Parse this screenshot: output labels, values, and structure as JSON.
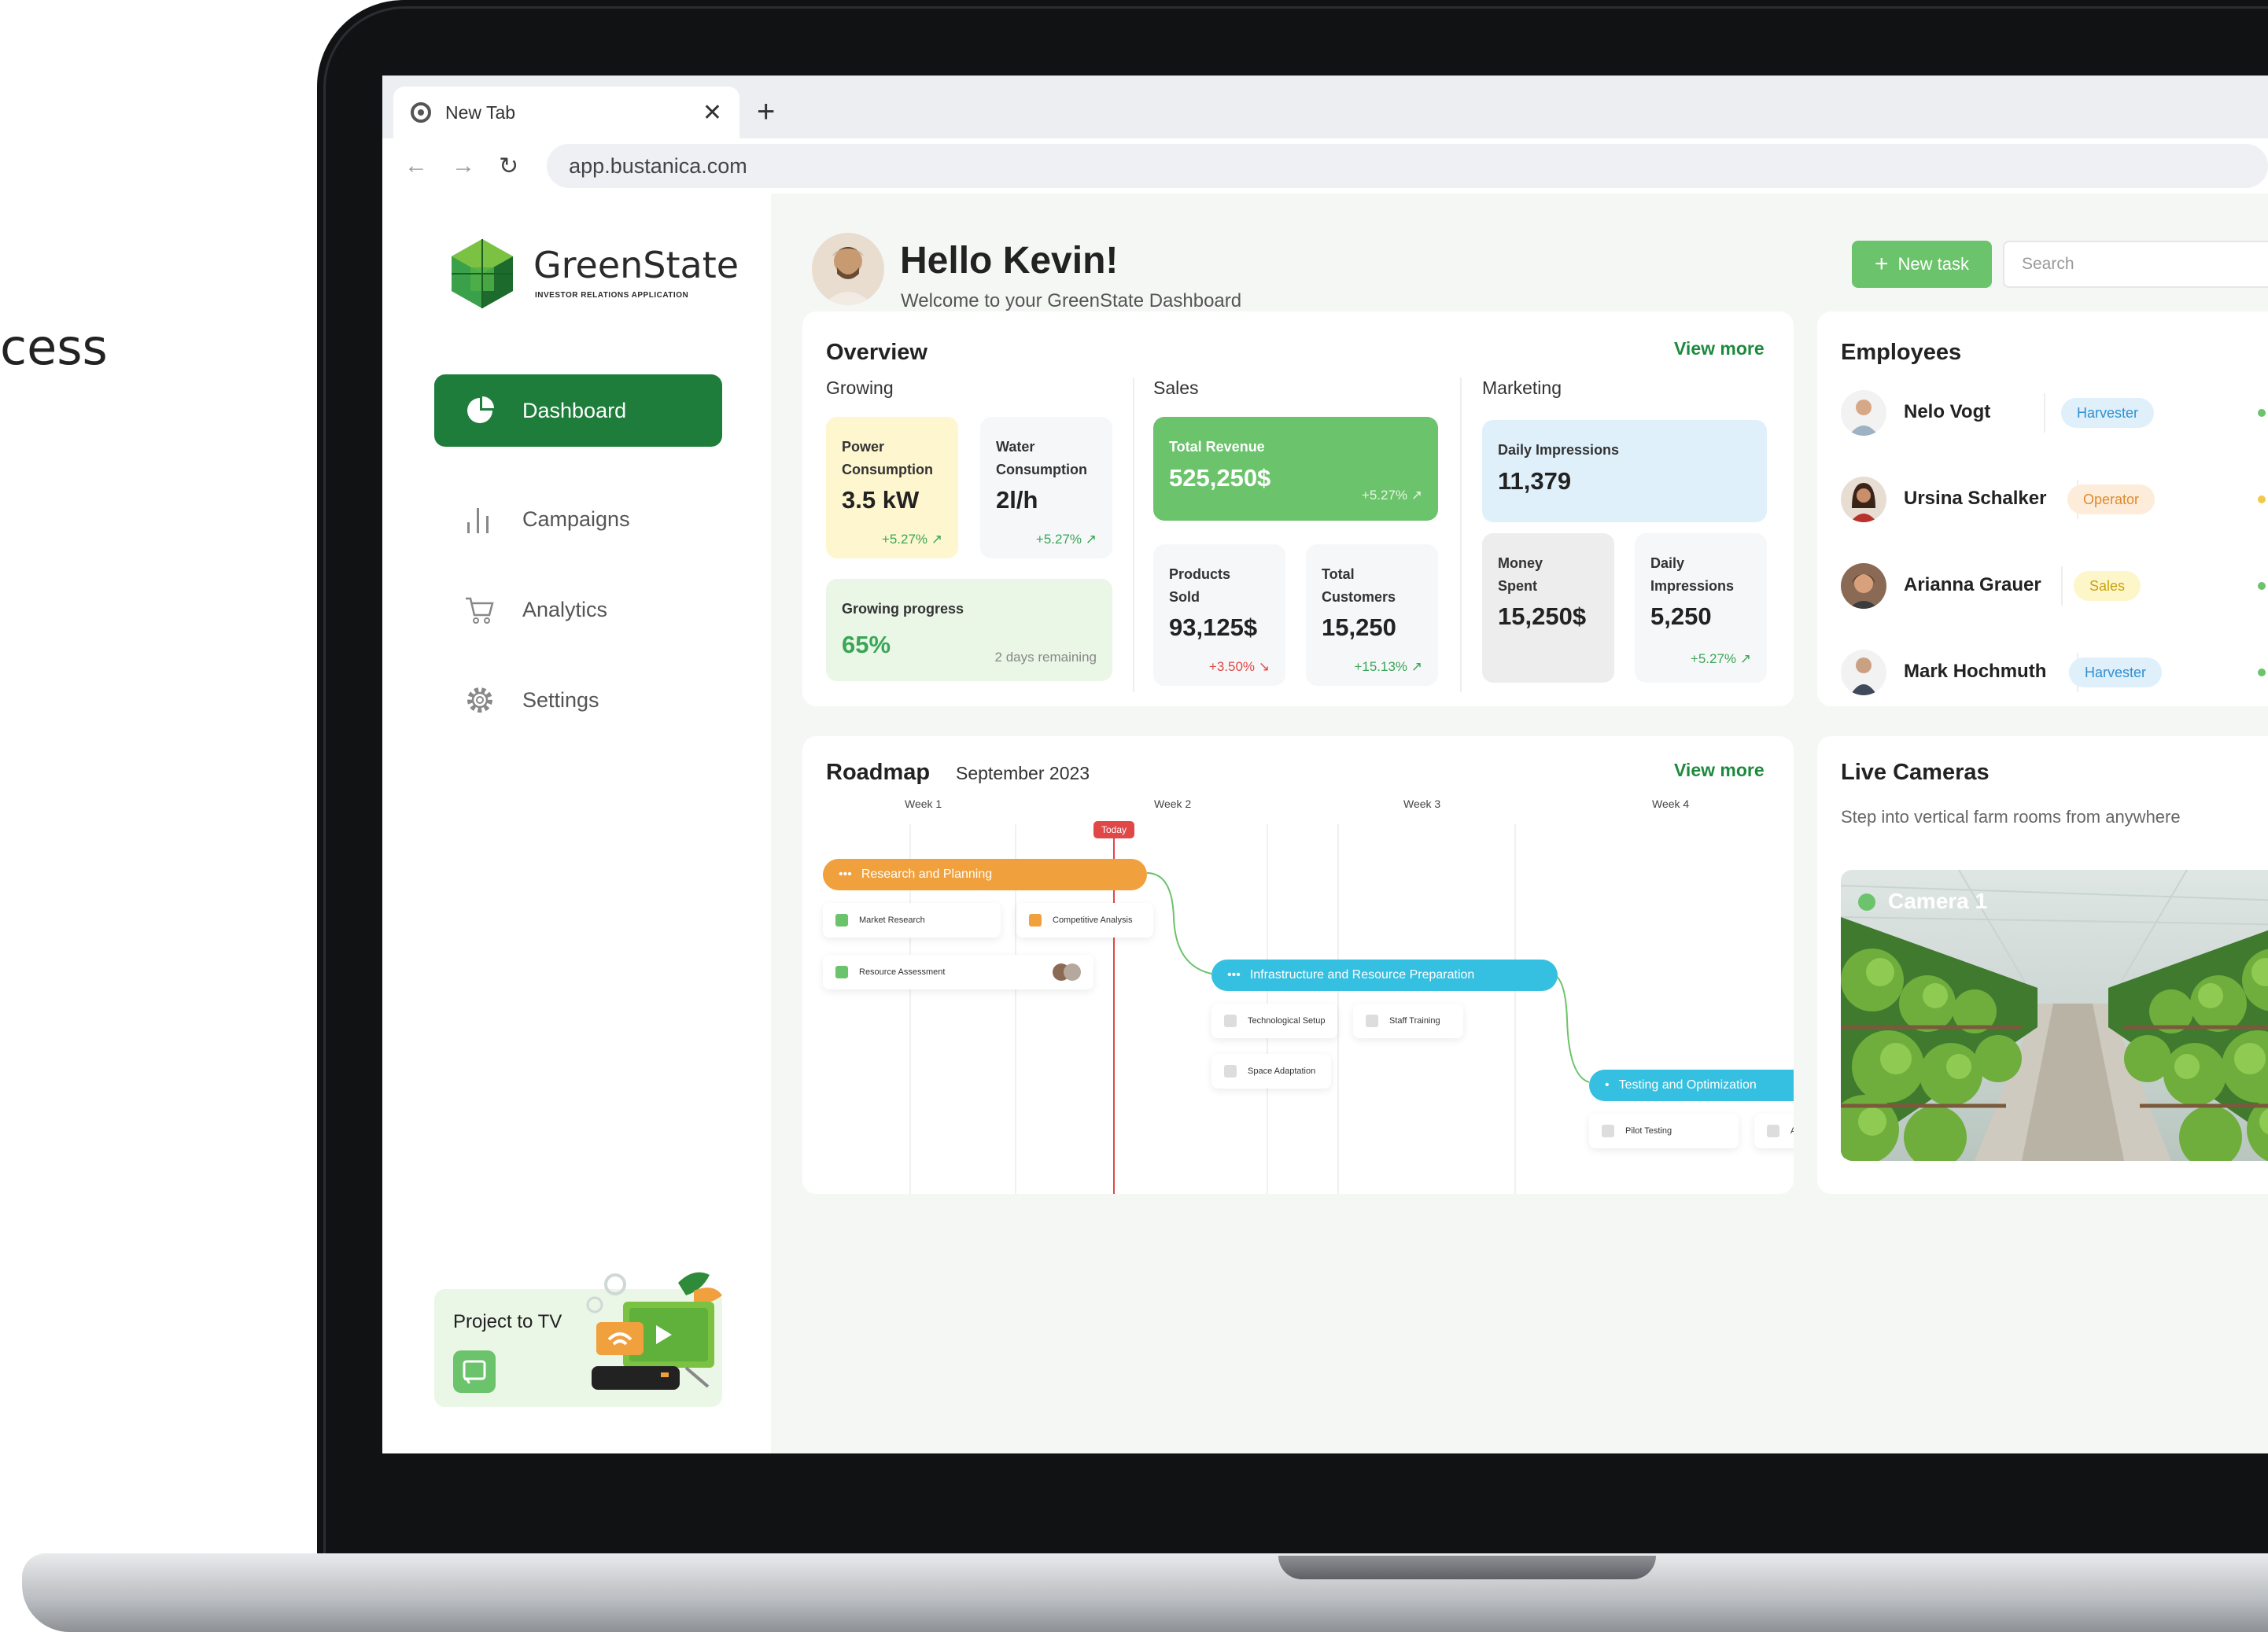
{
  "background_text": "cess",
  "browser": {
    "tab_title": "New Tab",
    "tab_close": "✕",
    "new_tab": "+",
    "back": "←",
    "forward": "→",
    "reload": "↻",
    "url": "app.bustanica.com"
  },
  "sidebar": {
    "brand_name": "GreenState",
    "brand_subtitle": "INVESTOR RELATIONS APPLICATION",
    "items": [
      {
        "label": "Dashboard",
        "icon": "pie-chart-icon",
        "active": true
      },
      {
        "label": "Campaigns",
        "icon": "bar-chart-icon",
        "active": false
      },
      {
        "label": "Analytics",
        "icon": "cart-icon",
        "active": false
      },
      {
        "label": "Settings",
        "icon": "gear-icon",
        "active": false
      }
    ],
    "project_to_tv": "Project to TV"
  },
  "header": {
    "greeting": "Hello Kevin!",
    "subtitle": "Welcome to your GreenState Dashboard",
    "new_task_label": "New task",
    "search_placeholder": "Search"
  },
  "overview": {
    "title": "Overview",
    "view_more": "View more",
    "growing": {
      "label": "Growing",
      "power": {
        "label_line1": "Power",
        "label_line2": "Consumption",
        "value": "3.5 kW",
        "delta": "+5.27%"
      },
      "water": {
        "label_line1": "Water",
        "label_line2": "Consumption",
        "value": "2l/h",
        "delta": "+5.27%"
      },
      "progress": {
        "label": "Growing progress",
        "value": "65%",
        "remaining": "2 days remaining"
      }
    },
    "sales": {
      "label": "Sales",
      "revenue": {
        "label": "Total Revenue",
        "value": "525,250$",
        "delta": "+5.27%"
      },
      "products": {
        "label_line1": "Products",
        "label_line2": "Sold",
        "value": "93,125$",
        "delta": "+3.50%"
      },
      "customers": {
        "label_line1": "Total",
        "label_line2": "Customers",
        "value": "15,250",
        "delta": "+15.13%"
      }
    },
    "marketing": {
      "label": "Marketing",
      "impressions": {
        "label": "Daily Impressions",
        "value": "11,379"
      },
      "money": {
        "label_line1": "Money",
        "label_line2": "Spent",
        "value": "15,250$"
      },
      "daily": {
        "label_line1": "Daily",
        "label_line2": "Impressions",
        "value": "5,250",
        "delta": "+5.27%"
      }
    }
  },
  "employees": {
    "title": "Employees",
    "list": [
      {
        "name": "Nelo Vogt",
        "role": "Harvester",
        "badge_bg": "#dff0fb",
        "badge_fg": "#2f8fd0",
        "dot": "#6bc36b"
      },
      {
        "name": "Ursina Schalker",
        "role": "Operator",
        "badge_bg": "#fdecd9",
        "badge_fg": "#e08a2c",
        "dot": "#f2c94c"
      },
      {
        "name": "Arianna Grauer",
        "role": "Sales",
        "badge_bg": "#fdf6c9",
        "badge_fg": "#c9a10f",
        "dot": "#6bc36b"
      },
      {
        "name": "Mark Hochmuth",
        "role": "Harvester",
        "badge_bg": "#dff0fb",
        "badge_fg": "#2f8fd0",
        "dot": "#6bc36b"
      }
    ]
  },
  "roadmap": {
    "title": "Roadmap",
    "period": "September 2023",
    "view_more": "View more",
    "today": "Today",
    "weeks": [
      "Week 1",
      "Week 2",
      "Week 3",
      "Week 4"
    ],
    "phases": [
      {
        "label": "Research and Planning",
        "color": "#f0a03c"
      },
      {
        "label": "Infrastructure and Resource Preparation",
        "color": "#35bfe0"
      },
      {
        "label": "Testing and Optimization",
        "color": "#35bfe0"
      }
    ],
    "tasks": [
      "Market Research",
      "Competitive Analysis",
      "Resource Assessment",
      "Technological Setup",
      "Staff Training",
      "Space Adaptation",
      "Pilot Testing",
      "A"
    ]
  },
  "cameras": {
    "title": "Live Cameras",
    "subtitle": "Step into vertical farm rooms from anywhere",
    "camera_label": "Camera 1"
  },
  "colors": {
    "brand_green": "#1e7d3b",
    "accent_green": "#6bc36b",
    "link_green": "#1e8a3e",
    "positive": "#3aa657",
    "negative": "#e04848"
  }
}
